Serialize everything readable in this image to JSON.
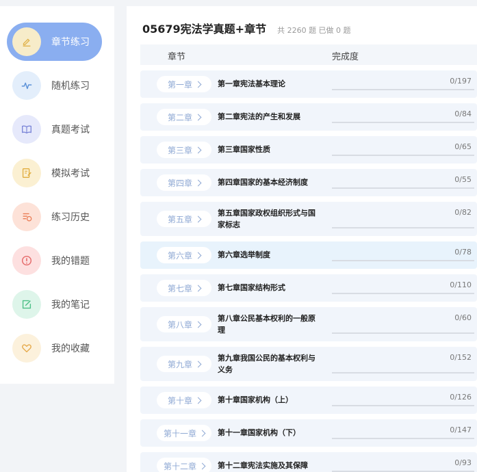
{
  "sidebar": {
    "items": [
      {
        "label": "章节练习",
        "icon": "pencil-icon",
        "active": true,
        "icon_bg": "#f7ecc9",
        "icon_color": "#e0b24a"
      },
      {
        "label": "随机练习",
        "icon": "pulse-icon",
        "active": false,
        "icon_bg": "#e3eefb",
        "icon_color": "#5c92d8"
      },
      {
        "label": "真题考试",
        "icon": "book-icon",
        "active": false,
        "icon_bg": "#e6e9fb",
        "icon_color": "#7c86d8"
      },
      {
        "label": "模拟考试",
        "icon": "document-edit-icon",
        "active": false,
        "icon_bg": "#fbf0d2",
        "icon_color": "#e1ad3f"
      },
      {
        "label": "练习历史",
        "icon": "history-list-icon",
        "active": false,
        "icon_bg": "#fde2d8",
        "icon_color": "#ea7a52"
      },
      {
        "label": "我的错题",
        "icon": "alert-icon",
        "active": false,
        "icon_bg": "#fde0e0",
        "icon_color": "#e56a6a"
      },
      {
        "label": "我的笔记",
        "icon": "note-edit-icon",
        "active": false,
        "icon_bg": "#def5ea",
        "icon_color": "#4cbf86"
      },
      {
        "label": "我的收藏",
        "icon": "heart-icon",
        "active": false,
        "icon_bg": "#fcf1dc",
        "icon_color": "#e6aa4b"
      }
    ]
  },
  "header": {
    "title": "05679宪法学真题+章节",
    "stats": "共 2260 题 已做 0 题"
  },
  "table": {
    "col_chapter": "章节",
    "col_progress": "完成度"
  },
  "chapters": [
    {
      "label": "第一章",
      "title": "第一章宪法基本理论",
      "done": 0,
      "total": 197,
      "count": "0/197"
    },
    {
      "label": "第二章",
      "title": "第二章宪法的产生和发展",
      "done": 0,
      "total": 84,
      "count": "0/84"
    },
    {
      "label": "第三章",
      "title": "第三章国家性质",
      "done": 0,
      "total": 65,
      "count": "0/65"
    },
    {
      "label": "第四章",
      "title": "第四章国家的基本经济制度",
      "done": 0,
      "total": 55,
      "count": "0/55"
    },
    {
      "label": "第五章",
      "title": "第五章国家政权组织形式与国家标志",
      "done": 0,
      "total": 82,
      "count": "0/82"
    },
    {
      "label": "第六章",
      "title": "第六章选举制度",
      "done": 0,
      "total": 78,
      "count": "0/78"
    },
    {
      "label": "第七章",
      "title": "第七章国家结构形式",
      "done": 0,
      "total": 110,
      "count": "0/110"
    },
    {
      "label": "第八章",
      "title": "第八章公民基本权利的一般原理",
      "done": 0,
      "total": 60,
      "count": "0/60"
    },
    {
      "label": "第九章",
      "title": "第九章我国公民的基本权利与义务",
      "done": 0,
      "total": 152,
      "count": "0/152"
    },
    {
      "label": "第十章",
      "title": "第十章国家机构（上）",
      "done": 0,
      "total": 126,
      "count": "0/126"
    },
    {
      "label": "第十一章",
      "title": "第十一章国家机构（下）",
      "done": 0,
      "total": 147,
      "count": "0/147"
    },
    {
      "label": "第十二章",
      "title": "第十二章宪法实施及其保障",
      "done": 0,
      "total": 93,
      "count": "0/93"
    }
  ]
}
